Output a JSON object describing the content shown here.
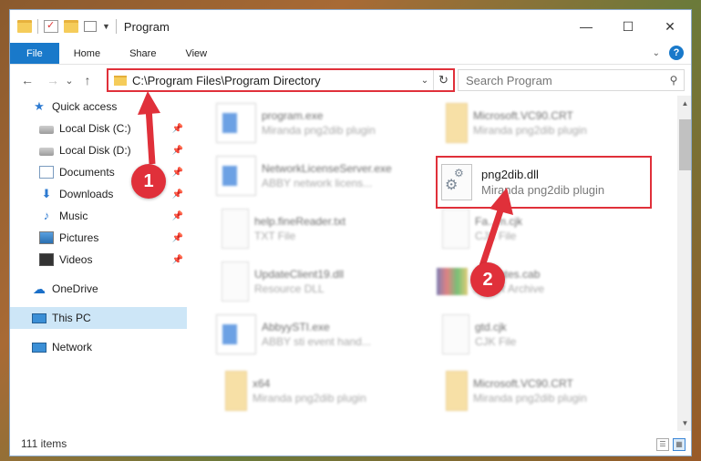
{
  "window": {
    "title": "Program",
    "controls": {
      "minimize": "—",
      "maximize": "☐",
      "close": "✕"
    }
  },
  "ribbon": {
    "tabs": [
      "File",
      "Home",
      "Share",
      "View"
    ],
    "file_color": "#1979ca"
  },
  "navigation": {
    "back": "←",
    "forward": "→",
    "recent": "⌄",
    "up": "↑",
    "address": "C:\\Program Files\\Program Directory",
    "search_placeholder": "Search Program"
  },
  "sidebar": {
    "quick_access": "Quick access",
    "items": [
      {
        "label": "Local Disk (C:)",
        "icon": "disk-icon",
        "pinned": true
      },
      {
        "label": "Local Disk (D:)",
        "icon": "disk-icon",
        "pinned": true
      },
      {
        "label": "Documents",
        "icon": "documents-icon",
        "pinned": true
      },
      {
        "label": "Downloads",
        "icon": "downloads-icon",
        "pinned": true
      },
      {
        "label": "Music",
        "icon": "music-icon",
        "pinned": true
      },
      {
        "label": "Pictures",
        "icon": "pictures-icon",
        "pinned": true
      },
      {
        "label": "Videos",
        "icon": "videos-icon",
        "pinned": true
      }
    ],
    "onedrive": "OneDrive",
    "this_pc": "This PC",
    "network": "Network"
  },
  "files": [
    {
      "name": "program.exe",
      "desc": "Miranda png2dib plugin",
      "icon": "exe-icon"
    },
    {
      "name": "Microsoft.VC90.CRT",
      "desc": "Miranda png2dib plugin",
      "icon": "folder-icon"
    },
    {
      "name": "NetworkLicenseServer.exe",
      "desc": "ABBY network licens...",
      "icon": "exe-icon"
    },
    {
      "name": "help.fineReader.txt",
      "desc": "TXT File",
      "icon": "txt-icon"
    },
    {
      "name": "Fa...m.cjk",
      "desc": "CJK File",
      "icon": "txt-icon"
    },
    {
      "name": "UpdateClient19.dll",
      "desc": "Resource DLL",
      "icon": "dll-icon"
    },
    {
      "name": "...tificates.cab",
      "desc": "...RAR Archive",
      "icon": "cab-icon"
    },
    {
      "name": "AbbyySTI.exe",
      "desc": "ABBY sti event hand...",
      "icon": "exe-icon"
    },
    {
      "name": "gtd.cjk",
      "desc": "CJK File",
      "icon": "txt-icon"
    },
    {
      "name": "x64",
      "desc": "Miranda png2dib plugin",
      "icon": "folder-icon"
    },
    {
      "name": "Microsoft.VC90.CRT",
      "desc": "Miranda png2dib plugin",
      "icon": "folder-icon"
    }
  ],
  "highlighted_file": {
    "name": "png2dib.dll",
    "desc": "Miranda png2dib plugin",
    "icon": "gear-file-icon"
  },
  "status": {
    "items": "111 items"
  },
  "annotations": {
    "step1": "1",
    "step2": "2",
    "color": "#e0303a"
  }
}
